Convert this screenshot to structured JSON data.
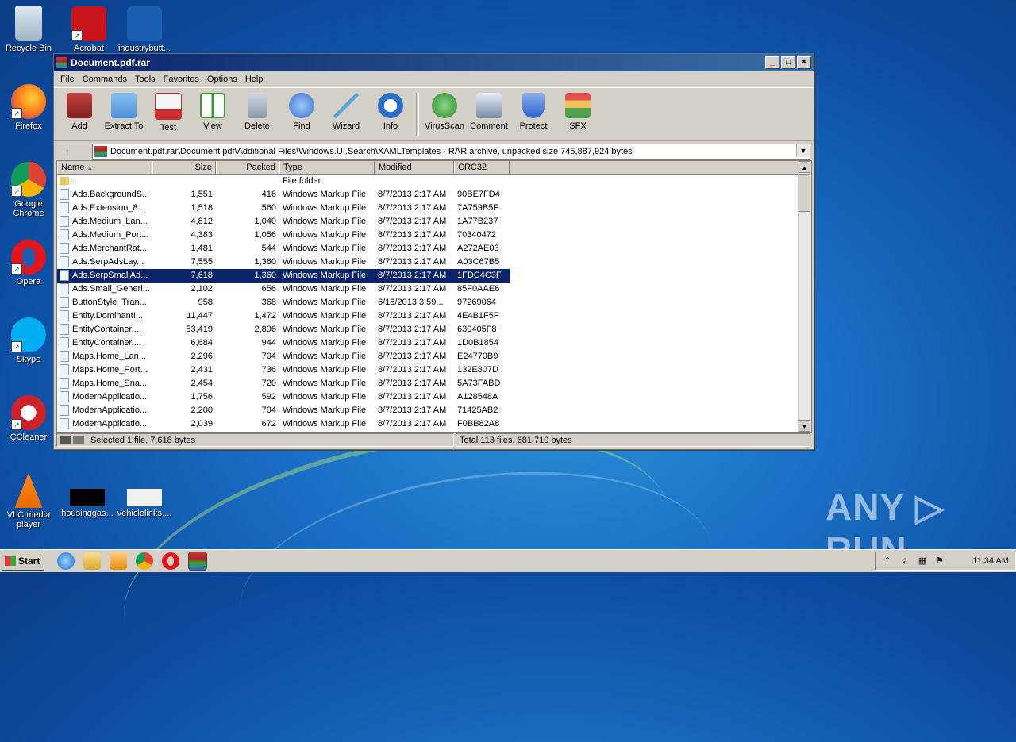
{
  "desktop": {
    "icons": [
      {
        "label": "Recycle Bin"
      },
      {
        "label": "Acrobat"
      },
      {
        "label": "industrybutt..."
      },
      {
        "label": "Firefox"
      },
      {
        "label": "Google Chrome"
      },
      {
        "label": "Opera"
      },
      {
        "label": "Skype"
      },
      {
        "label": "CCleaner"
      },
      {
        "label": "VLC media player"
      },
      {
        "label": "housinggas..."
      },
      {
        "label": "vehiclelinks...."
      }
    ],
    "watermark": "ANY ▷ RUN"
  },
  "window": {
    "title": "Document.pdf.rar",
    "menu": [
      "File",
      "Commands",
      "Tools",
      "Favorites",
      "Options",
      "Help"
    ],
    "toolbar": [
      {
        "label": "Add",
        "icon": "add-archive-icon",
        "color": "#c04040"
      },
      {
        "label": "Extract To",
        "icon": "extract-folder-icon",
        "color": "#4a90d8"
      },
      {
        "label": "Test",
        "icon": "test-clipboard-icon",
        "color": "#c83030"
      },
      {
        "label": "View",
        "icon": "view-book-icon",
        "color": "#3a9a3a"
      },
      {
        "label": "Delete",
        "icon": "delete-bin-icon",
        "color": "#8a9aa8"
      },
      {
        "label": "Find",
        "icon": "find-magnifier-icon",
        "color": "#3a70c8"
      },
      {
        "label": "Wizard",
        "icon": "wizard-wand-icon",
        "color": "#50a8d8"
      },
      {
        "label": "Info",
        "icon": "info-icon",
        "color": "#2a70c8"
      },
      {
        "label": "VirusScan",
        "icon": "virusscan-bug-icon",
        "color": "#2a8a2a"
      },
      {
        "label": "Comment",
        "icon": "comment-icon",
        "color": "#7a8aa8"
      },
      {
        "label": "Protect",
        "icon": "protect-shield-icon",
        "color": "#2a60c8"
      },
      {
        "label": "SFX",
        "icon": "sfx-box-icon",
        "color": "#c88a30"
      }
    ],
    "address": "Document.pdf.rar\\Document.pdf\\Additional Files\\Windows.UI.Search\\XAMLTemplates - RAR archive, unpacked size 745,887,924 bytes",
    "columns": [
      "Name",
      "Size",
      "Packed",
      "Type",
      "Modified",
      "CRC32"
    ],
    "rows": [
      {
        "name": "..",
        "size": "",
        "packed": "",
        "type": "File folder",
        "modified": "",
        "crc": "",
        "folder": true
      },
      {
        "name": "Ads.BackgroundS...",
        "size": "1,551",
        "packed": "416",
        "type": "Windows Markup File",
        "modified": "8/7/2013 2:17 AM",
        "crc": "90BE7FD4"
      },
      {
        "name": "Ads.Extension_8...",
        "size": "1,518",
        "packed": "560",
        "type": "Windows Markup File",
        "modified": "8/7/2013 2:17 AM",
        "crc": "7A759B5F"
      },
      {
        "name": "Ads.Medium_Lan...",
        "size": "4,812",
        "packed": "1,040",
        "type": "Windows Markup File",
        "modified": "8/7/2013 2:17 AM",
        "crc": "1A77B237"
      },
      {
        "name": "Ads.Medium_Port...",
        "size": "4,383",
        "packed": "1,056",
        "type": "Windows Markup File",
        "modified": "8/7/2013 2:17 AM",
        "crc": "70340472"
      },
      {
        "name": "Ads.MerchantRat...",
        "size": "1,481",
        "packed": "544",
        "type": "Windows Markup File",
        "modified": "8/7/2013 2:17 AM",
        "crc": "A272AE03"
      },
      {
        "name": "Ads.SerpAdsLay...",
        "size": "7,555",
        "packed": "1,360",
        "type": "Windows Markup File",
        "modified": "8/7/2013 2:17 AM",
        "crc": "A03C67B5"
      },
      {
        "name": "Ads.SerpSmallAd...",
        "size": "7,618",
        "packed": "1,360",
        "type": "Windows Markup File",
        "modified": "8/7/2013 2:17 AM",
        "crc": "1FDC4C3F",
        "selected": true
      },
      {
        "name": "Ads.Small_Generi...",
        "size": "2,102",
        "packed": "656",
        "type": "Windows Markup File",
        "modified": "8/7/2013 2:17 AM",
        "crc": "85F0AAE6"
      },
      {
        "name": "ButtonStyle_Tran...",
        "size": "958",
        "packed": "368",
        "type": "Windows Markup File",
        "modified": "6/18/2013 3:59...",
        "crc": "97269064"
      },
      {
        "name": "Entity.DominantI...",
        "size": "11,447",
        "packed": "1,472",
        "type": "Windows Markup File",
        "modified": "8/7/2013 2:17 AM",
        "crc": "4E4B1F5F"
      },
      {
        "name": "EntityContainer....",
        "size": "53,419",
        "packed": "2,896",
        "type": "Windows Markup File",
        "modified": "8/7/2013 2:17 AM",
        "crc": "630405F8"
      },
      {
        "name": "EntityContainer....",
        "size": "6,684",
        "packed": "944",
        "type": "Windows Markup File",
        "modified": "8/7/2013 2:17 AM",
        "crc": "1D0B1854"
      },
      {
        "name": "Maps.Home_Lan...",
        "size": "2,296",
        "packed": "704",
        "type": "Windows Markup File",
        "modified": "8/7/2013 2:17 AM",
        "crc": "E24770B9"
      },
      {
        "name": "Maps.Home_Port...",
        "size": "2,431",
        "packed": "736",
        "type": "Windows Markup File",
        "modified": "8/7/2013 2:17 AM",
        "crc": "132E807D"
      },
      {
        "name": "Maps.Home_Sna...",
        "size": "2,454",
        "packed": "720",
        "type": "Windows Markup File",
        "modified": "8/7/2013 2:17 AM",
        "crc": "5A73FABD"
      },
      {
        "name": "ModernApplicatio...",
        "size": "1,756",
        "packed": "592",
        "type": "Windows Markup File",
        "modified": "8/7/2013 2:17 AM",
        "crc": "A128548A"
      },
      {
        "name": "ModernApplicatio...",
        "size": "2,200",
        "packed": "704",
        "type": "Windows Markup File",
        "modified": "8/7/2013 2:17 AM",
        "crc": "71425AB2"
      },
      {
        "name": "ModernApplicatio...",
        "size": "2,039",
        "packed": "672",
        "type": "Windows Markup File",
        "modified": "8/7/2013 2:17 AM",
        "crc": "F0BB82A8"
      }
    ],
    "status_left": "Selected 1 file, 7,618 bytes",
    "status_right": "Total 113 files, 681,710 bytes"
  },
  "taskbar": {
    "start_label": "Start",
    "clock": "11:34 AM"
  }
}
